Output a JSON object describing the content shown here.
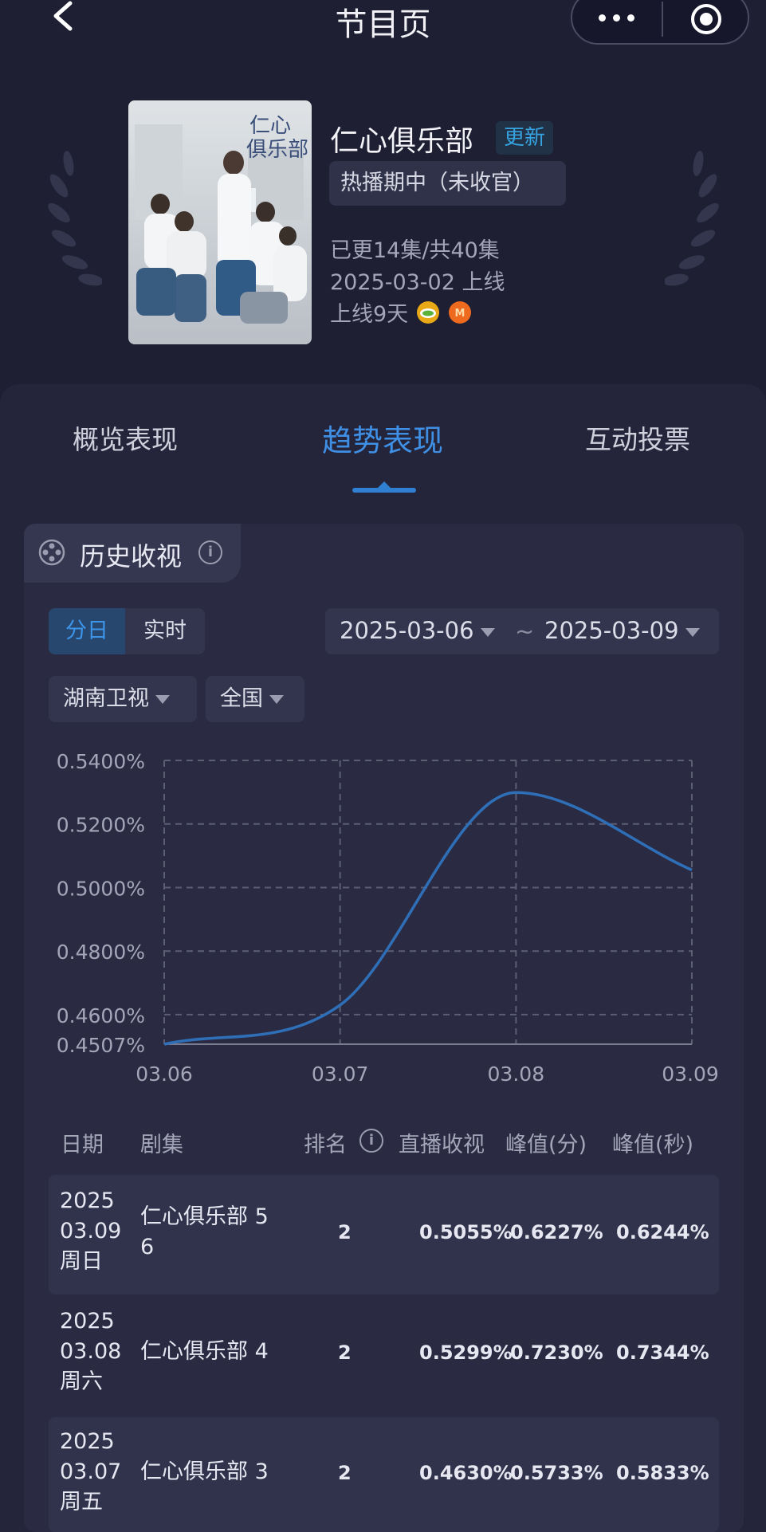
{
  "header": {
    "title": "节目页"
  },
  "show": {
    "title": "仁心俱乐部",
    "update_badge": "更新",
    "status": "热播期中（未收官）",
    "episodes_info": "已更14集/共40集",
    "launch_date": "2025-03-02 上线",
    "days_online": "上线9天",
    "network_icons": [
      "hunan-tv-icon",
      "mango-tv-icon"
    ],
    "poster_text": "仁心俱乐部"
  },
  "tabs": [
    {
      "label": "概览表现",
      "active": false
    },
    {
      "label": "趋势表现",
      "active": true
    },
    {
      "label": "互动投票",
      "active": false
    }
  ],
  "history": {
    "title": "历史收视",
    "mode_options": [
      {
        "label": "分日",
        "selected": true
      },
      {
        "label": "实时",
        "selected": false
      }
    ],
    "date_start": "2025-03-06",
    "date_sep": "~",
    "date_end": "2025-03-09",
    "channel": "湖南卫视",
    "region": "全国"
  },
  "chart_data": {
    "type": "line",
    "x": [
      "03.06",
      "03.07",
      "03.08",
      "03.09"
    ],
    "series": [
      {
        "values": [
          0.4507,
          0.463,
          0.5299,
          0.5055
        ]
      }
    ],
    "y_tick_labels": [
      "0.5400%",
      "0.5200%",
      "0.5000%",
      "0.4800%",
      "0.4600%",
      "0.4507%"
    ],
    "y_ticks": [
      0.54,
      0.52,
      0.5,
      0.48,
      0.46,
      0.4507
    ],
    "ylim": [
      0.4507,
      0.54
    ],
    "grid": true,
    "line_color": "#2f6fb8",
    "grid_color": "#5c5e74"
  },
  "table": {
    "headers": [
      "日期",
      "剧集",
      "排名",
      "直播收视",
      "峰值(分)",
      "峰值(秒)"
    ],
    "rows": [
      {
        "year": "2025",
        "date": "03.09",
        "weekday": "周日",
        "episode": "仁心俱乐部 5",
        "episode2": "6",
        "rank": "2",
        "live": "0.5055%",
        "peak_min": "0.6227%",
        "peak_sec": "0.6244%"
      },
      {
        "year": "2025",
        "date": "03.08",
        "weekday": "周六",
        "episode": "仁心俱乐部 4",
        "episode2": "",
        "rank": "2",
        "live": "0.5299%",
        "peak_min": "0.7230%",
        "peak_sec": "0.7344%"
      },
      {
        "year": "2025",
        "date": "03.07",
        "weekday": "周五",
        "episode": "仁心俱乐部 3",
        "episode2": "",
        "rank": "2",
        "live": "0.4630%",
        "peak_min": "0.5733%",
        "peak_sec": "0.5833%"
      }
    ]
  }
}
